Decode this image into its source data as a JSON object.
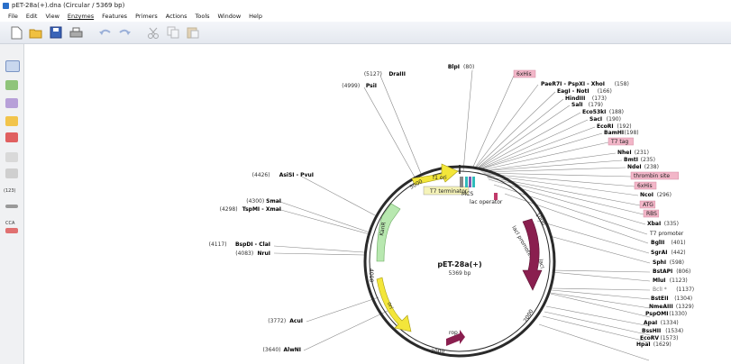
{
  "window": {
    "title": "pET-28a(+).dna (Circular / 5369 bp)"
  },
  "menu": [
    "File",
    "Edit",
    "View",
    "Enzymes",
    "Features",
    "Primers",
    "Actions",
    "Tools",
    "Window",
    "Help"
  ],
  "sidebar": {
    "label_a": "(123)",
    "label_b": "CCA"
  },
  "map": {
    "name": "pET-28a(+)",
    "size": "5369 bp",
    "ticks": [
      "5000",
      "1000",
      "2000",
      "3000",
      "4000"
    ],
    "features": [
      "f1 ori",
      "T7 terminator",
      "MCS",
      "lac operator",
      "lacI promoter",
      "lacI",
      "KanR",
      "ori",
      "rop"
    ],
    "left_sites": [
      {
        "pos": "(5127)",
        "name": "DraIII"
      },
      {
        "pos": "(4999)",
        "name": "PsiI"
      },
      {
        "pos": "(4426)",
        "name": "AsiSI - PvuI"
      },
      {
        "pos": "(4300)",
        "name": "SmaI"
      },
      {
        "pos": "(4298)",
        "name": "TspMI - XmaI"
      },
      {
        "pos": "(4117)",
        "name": "BspDI - ClaI"
      },
      {
        "pos": "(4083)",
        "name": "NruI"
      },
      {
        "pos": "(3772)",
        "name": "AcuI"
      },
      {
        "pos": "(3640)",
        "name": "AlwNI"
      }
    ],
    "top_site": {
      "name": "BlpI",
      "pos": "(80)"
    },
    "right_sites": [
      {
        "name": "6xHis",
        "pos": "",
        "tag": true
      },
      {
        "name": "PaeR7I - PspXI - XhoI",
        "pos": "(158)"
      },
      {
        "name": "EagI - NotI",
        "pos": "(166)"
      },
      {
        "name": "HindIII",
        "pos": "(173)"
      },
      {
        "name": "SalI",
        "pos": "(179)"
      },
      {
        "name": "Eco53kI",
        "pos": "(188)"
      },
      {
        "name": "SacI",
        "pos": "(190)"
      },
      {
        "name": "EcoRI",
        "pos": "(192)"
      },
      {
        "name": "BamHI",
        "pos": "(198)"
      },
      {
        "name": "T7 tag",
        "pos": "",
        "tag": true
      },
      {
        "name": "NheI",
        "pos": "(231)"
      },
      {
        "name": "BmtI",
        "pos": "(235)"
      },
      {
        "name": "NdeI",
        "pos": "(238)"
      },
      {
        "name": "thrombin site",
        "pos": "",
        "tag": true
      },
      {
        "name": "6xHis",
        "pos": "",
        "tag": true
      },
      {
        "name": "NcoI",
        "pos": "(296)"
      },
      {
        "name": "ATG",
        "pos": "",
        "tag": true
      },
      {
        "name": "RBS",
        "pos": "",
        "tag": true
      },
      {
        "name": "XbaI",
        "pos": "(335)"
      },
      {
        "name": "T7 promoter",
        "pos": "",
        "tag": true,
        "plain": true
      },
      {
        "name": "BglII",
        "pos": "(401)"
      },
      {
        "name": "SgrAI",
        "pos": "(442)"
      },
      {
        "name": "SphI",
        "pos": "(598)"
      },
      {
        "name": "BstAPI",
        "pos": "(806)"
      },
      {
        "name": "MluI",
        "pos": "(1123)"
      },
      {
        "name": "BclI *",
        "pos": "(1137)",
        "light": true
      },
      {
        "name": "BstEII",
        "pos": "(1304)"
      },
      {
        "name": "NmeAIII",
        "pos": "(1329)"
      },
      {
        "name": "PspOMI",
        "pos": "(1330)"
      },
      {
        "name": "ApaI",
        "pos": "(1334)"
      },
      {
        "name": "BssHII",
        "pos": "(1534)"
      },
      {
        "name": "EcoRV",
        "pos": "(1573)"
      },
      {
        "name": "HpaI",
        "pos": "(1629)"
      }
    ]
  }
}
